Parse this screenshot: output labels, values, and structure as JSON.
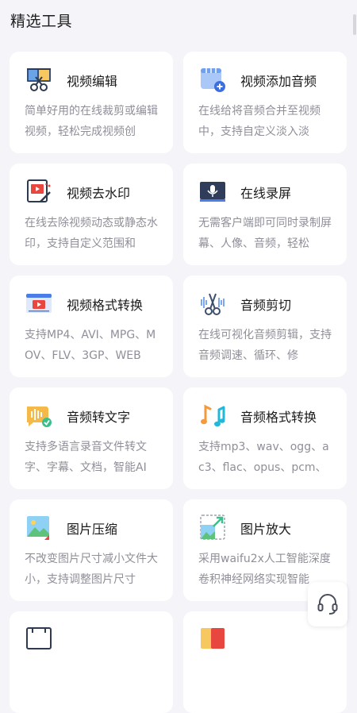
{
  "header": {
    "title": "精选工具"
  },
  "tools": [
    {
      "title": "视频编辑",
      "desc": "简单好用的在线裁剪或编辑视频，轻松完成视频创"
    },
    {
      "title": "视频添加音频",
      "desc": "在线给将音频合并至视频中，支持自定义淡入淡"
    },
    {
      "title": "视频去水印",
      "desc": "在线去除视频动态或静态水印，支持自定义范围和"
    },
    {
      "title": "在线录屏",
      "desc": "无需客户端即可同时录制屏幕、人像、音频，轻松"
    },
    {
      "title": "视频格式转换",
      "desc": "支持MP4、AVI、MPG、MOV、FLV、3GP、WEB"
    },
    {
      "title": "音频剪切",
      "desc": "在线可视化音频剪辑，支持音频调速、循环、修"
    },
    {
      "title": "音频转文字",
      "desc": "支持多语言录音文件转文字、字幕、文档，智能AI"
    },
    {
      "title": "音频格式转换",
      "desc": "支持mp3、wav、ogg、ac3、flac、opus、pcm、"
    },
    {
      "title": "图片压缩",
      "desc": "不改变图片尺寸减小文件大小，支持调整图片尺寸"
    },
    {
      "title": "图片放大",
      "desc": "采用waifu2x人工智能深度卷积神经网络实现智能"
    }
  ],
  "icons": {
    "floating": "headset-icon"
  },
  "colors": {
    "background": "#f4f4f9",
    "card": "#ffffff",
    "title_text": "#1a1a1a",
    "desc_text": "#8f8f99",
    "accent_blue": "#4a7de8",
    "accent_orange": "#f39a3c"
  }
}
